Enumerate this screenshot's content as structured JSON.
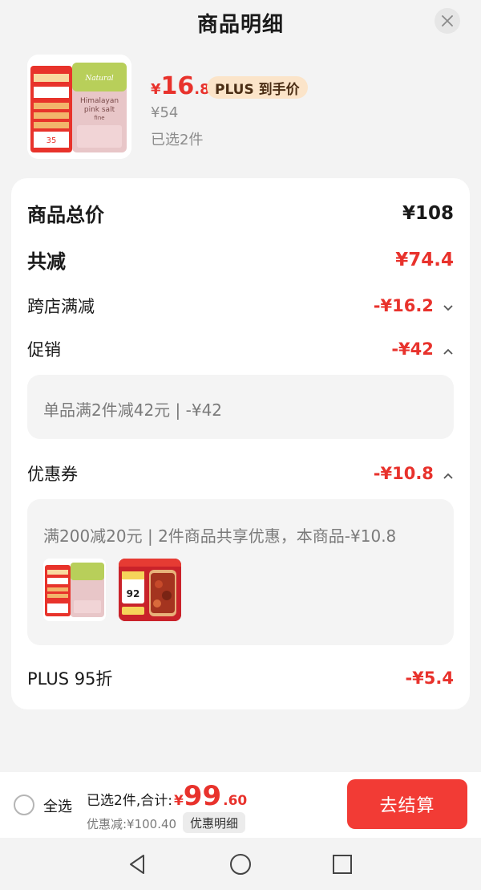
{
  "header": {
    "title": "商品明细"
  },
  "product": {
    "price_currency": "¥",
    "price_integer": "16",
    "price_decimal": ".8",
    "plus_tag": "PLUS 到手价",
    "original_price": "¥54",
    "selected_count": "已选2件",
    "image_text": {
      "brand": "Natural",
      "name_line1": "Himalayan",
      "name_line2": "pink salt",
      "name_line3": "fine",
      "promo_price": "35"
    }
  },
  "summary": {
    "total_label": "商品总价",
    "total_value": "¥108",
    "reduce_label": "共减",
    "reduce_value": "¥74.4",
    "cross_store_label": "跨店满减",
    "cross_store_value": "-¥16.2",
    "promo_label": "促销",
    "promo_value": "-¥42",
    "promo_detail": "单品满2件减42元 | -¥42",
    "coupon_label": "优惠券",
    "coupon_value": "-¥10.8",
    "coupon_detail": "满200减20元 | 2件商品共享优惠，本商品-¥10.8",
    "coupon_item2_price": "92",
    "plus_label": "PLUS 95折",
    "plus_value": "-¥5.4"
  },
  "bottom": {
    "select_all": "全选",
    "selected_total_label": "已选2件,合计:",
    "total_currency": "¥",
    "total_integer": "99",
    "total_decimal": ".60",
    "discount_text": "优惠减:¥100.40",
    "detail_button": "优惠明细",
    "checkout_button": "去结算"
  },
  "colors": {
    "accent_red": "#e8322c",
    "checkout_red": "#f23b35",
    "plus_tag_bg": "#fbe4c9"
  }
}
